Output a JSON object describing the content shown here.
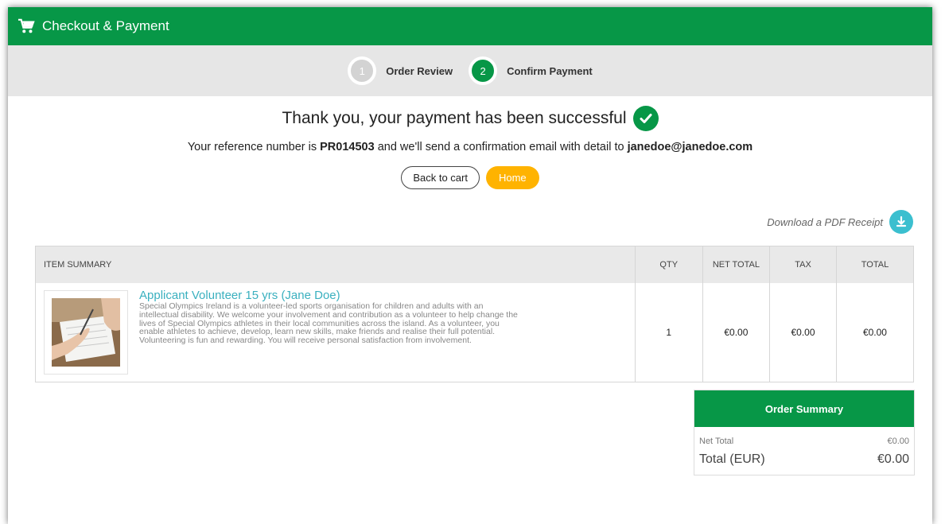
{
  "header": {
    "title": "Checkout & Payment",
    "icon": "cart-icon",
    "color": "#079747"
  },
  "steps": [
    {
      "number": "1",
      "label": "Order Review",
      "state": "inactive"
    },
    {
      "number": "2",
      "label": "Confirm Payment",
      "state": "active"
    }
  ],
  "message": {
    "title": "Thank you, your payment has been successful",
    "ref_prefix": "Your reference number is",
    "ref_number": "PR014503",
    "ref_middle": "and we'll send a confirmation email with detail to",
    "email": "janedoe@janedoe.com"
  },
  "buttons": {
    "back": "Back to cart",
    "home": "Home",
    "home_color": "#ffb300"
  },
  "download": {
    "label": "Download a PDF Receipt",
    "icon": "download-icon"
  },
  "table": {
    "headers": [
      "ITEM SUMMARY",
      "QTY",
      "NET TOTAL",
      "TAX",
      "TOTAL"
    ],
    "rows": [
      {
        "name": "Applicant Volunteer 15 yrs (Jane Doe)",
        "description_lines": [
          "Special Olympics Ireland is a volunteer-led sports organisation for children and adults with an",
          "intellectual disability. We welcome your involvement and contribution as a volunteer to help change the",
          "lives of Special Olympics athletes in their local communities across the island. As a volunteer, you",
          "enable athletes to achieve, develop, learn new skills, make friends and realise their full potential.",
          "Volunteering is fun and rewarding. You will receive personal satisfaction from involvement."
        ],
        "qty": "1",
        "net_total": "€0.00",
        "tax": "€0.00",
        "total": "€0.00"
      }
    ]
  },
  "summary": {
    "title": "Order Summary",
    "net_label": "Net Total",
    "net_value": "€0.00",
    "total_label": "Total (EUR)",
    "total_value": "€0.00"
  }
}
